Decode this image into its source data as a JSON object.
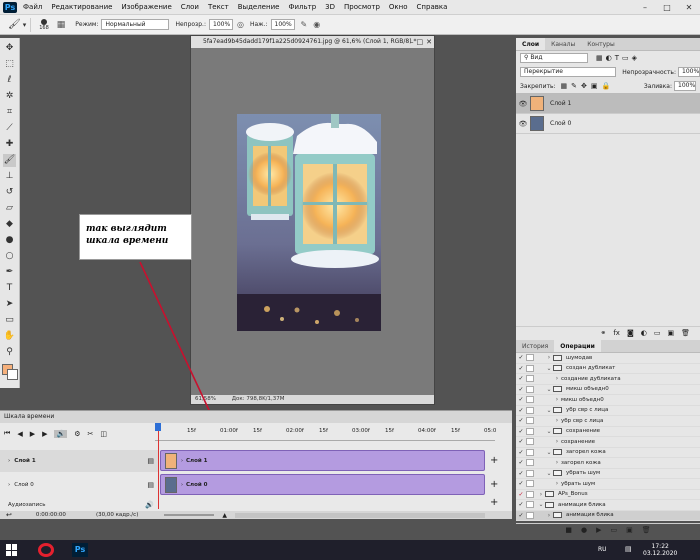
{
  "menu": {
    "logo": "Ps",
    "items": [
      "Файл",
      "Редактирование",
      "Изображение",
      "Слои",
      "Текст",
      "Выделение",
      "Фильтр",
      "3D",
      "Просмотр",
      "Окно",
      "Справка"
    ]
  },
  "window_controls": {
    "min": "–",
    "max": "□",
    "close": "✕"
  },
  "options": {
    "brush_size": "168",
    "mode_label": "Режим:",
    "mode_value": "Нормальный",
    "opacity_label": "Непрозр.:",
    "opacity_value": "100%",
    "flow_label": "Наж.:",
    "flow_value": "100%"
  },
  "document": {
    "title": "5fa7ead9b45dadd179f1a225d0924761.jpg @ 61,6% (Слой 1, RGB/8) *",
    "zoom": "61,58%",
    "doc_size": "Док: 798,8K/1,37M"
  },
  "callout": {
    "line1": "так выглядит",
    "line2": "шкала времени"
  },
  "layers_panel": {
    "tabs": [
      "Слои",
      "Каналы",
      "Контуры"
    ],
    "kind": "Вид",
    "blend": "Перекрытие",
    "opacity_label": "Непрозрачность:",
    "opacity_value": "100%",
    "lock_label": "Закрепить:",
    "fill_label": "Заливка:",
    "fill_value": "100%",
    "layers": [
      {
        "name": "Слой 1",
        "selected": true
      },
      {
        "name": "Слой 0",
        "selected": false
      }
    ]
  },
  "actions_panel": {
    "tabs": [
      "История",
      "Операции"
    ],
    "items": [
      {
        "label": "шумодав",
        "indent": 1,
        "folder": false,
        "expanded": false,
        "checked": true
      },
      {
        "label": "создан дубликат",
        "indent": 1,
        "folder": false,
        "expanded": true,
        "checked": true
      },
      {
        "label": "создание дубликата",
        "indent": 2,
        "folder": false,
        "expanded": false,
        "checked": true
      },
      {
        "label": "микш объедн0",
        "indent": 1,
        "folder": false,
        "expanded": true,
        "checked": true
      },
      {
        "label": "микш объедн0",
        "indent": 2,
        "folder": false,
        "expanded": false,
        "checked": true
      },
      {
        "label": "убр свр с лица",
        "indent": 1,
        "folder": false,
        "expanded": true,
        "checked": true
      },
      {
        "label": "убр свр с лица",
        "indent": 2,
        "folder": false,
        "expanded": false,
        "checked": true
      },
      {
        "label": "сохранение",
        "indent": 1,
        "folder": false,
        "expanded": true,
        "checked": true
      },
      {
        "label": "сохранение",
        "indent": 2,
        "folder": false,
        "expanded": false,
        "checked": true
      },
      {
        "label": "загорел кожа",
        "indent": 1,
        "folder": false,
        "expanded": true,
        "checked": true
      },
      {
        "label": "загорел кожа",
        "indent": 2,
        "folder": false,
        "expanded": false,
        "checked": true
      },
      {
        "label": "убрать шум",
        "indent": 1,
        "folder": false,
        "expanded": true,
        "checked": true
      },
      {
        "label": "убрать шум",
        "indent": 2,
        "folder": false,
        "expanded": false,
        "checked": true
      },
      {
        "label": "APs_Bonus",
        "indent": 0,
        "folder": true,
        "expanded": false,
        "checked": true,
        "red": true
      },
      {
        "label": "анимация блика",
        "indent": 0,
        "folder": true,
        "expanded": true,
        "checked": true
      },
      {
        "label": "анимация блика",
        "indent": 1,
        "folder": false,
        "expanded": false,
        "checked": true,
        "selected": true
      }
    ]
  },
  "timeline": {
    "title": "Шкала времени",
    "ruler": [
      "15f",
      "01:00f",
      "15f",
      "02:00f",
      "15f",
      "03:00f",
      "15f",
      "04:00f",
      "15f",
      "05:0"
    ],
    "tracks": [
      {
        "name": "Слой 1",
        "clip": "Слой 1"
      },
      {
        "name": "Слой 0",
        "clip": "Слой 0"
      }
    ],
    "audio_label": "Аудиозапись",
    "timecode": "0:00:00:00",
    "fps": "(30,00 кадр./с)"
  },
  "taskbar": {
    "lang": "RU",
    "time": "17:22",
    "date": "03.12.2020"
  }
}
